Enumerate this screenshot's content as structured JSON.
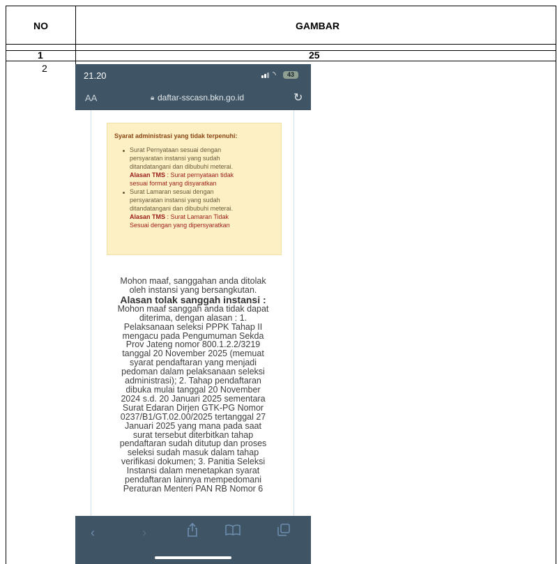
{
  "table": {
    "headers": {
      "no": "NO",
      "gambar": "GAMBAR"
    },
    "rows": [
      {
        "no": "1",
        "gambar": "25"
      },
      {
        "no": "2"
      }
    ]
  },
  "phone": {
    "status": {
      "time": "21.20",
      "battery": "43"
    },
    "browser": {
      "aa": "AA",
      "url": "daftar-sscasn.bkn.go.id"
    },
    "warning": {
      "title": "Syarat administrasi yang tidak terpenuhi:",
      "item1_lines": [
        "Surat Pernyataan sesuai dengan",
        "persyaratan instansi yang sudah",
        "ditandatangani dan dibubuhi meterai."
      ],
      "item1_reason_label": "Alasan TMS",
      "item1_reason_line1": " : Surat pernyataan tidak",
      "item1_reason_line2": "sesuai format yang disyaratkan",
      "item2_lines": [
        "Surat Lamaran sesuai dengan",
        "persyaratan instansi yang sudah",
        "ditandatangani dan dibubuhi meterai."
      ],
      "item2_reason_label": "Alasan TMS",
      "item2_reason_line1": " : Surat Lamaran Tidak",
      "item2_reason_line2": "Sesuai dengan yang dipersyaratkan"
    },
    "message": {
      "intro_lines": [
        "Mohon maaf, sanggahan anda ditolak",
        "oleh instansi yang bersangkutan."
      ],
      "heading": "Alasan tolak sanggah instansi :",
      "body_lines": [
        "Mohon maaf sanggah anda tidak dapat",
        "diterima, dengan alasan : 1.",
        "Pelaksanaan seleksi PPPK Tahap II",
        "mengacu pada Pengumuman Sekda",
        "Prov Jateng nomor 800.1.2.2/3219",
        "tanggal 20 November 2025 (memuat",
        "syarat pendaftaran yang menjadi",
        "pedoman dalam pelaksanaan seleksi",
        "administrasi); 2. Tahap pendaftaran",
        "dibuka mulai tanggal 20 November",
        "2024 s.d. 20 Januari 2025 sementara",
        "Surat Edaran Dirjen GTK-PG Nomor",
        "0237/B1/GT.02.00/2025 tertanggal 27",
        "Januari 2025 yang mana pada saat",
        "surat tersebut diterbitkan tahap",
        "pendaftaran sudah ditutup dan proses",
        "seleksi sudah masuk dalam tahap",
        "verifikasi dokumen; 3. Panitia Seleksi",
        "Instansi dalam menetapkan syarat",
        "pendaftaran lainnya mempedomani",
        "Peraturan Menteri PAN RB Nomor 6"
      ]
    },
    "toolbar_icons": [
      "back-icon",
      "forward-icon",
      "share-icon",
      "bookmarks-icon",
      "tabs-icon"
    ]
  }
}
